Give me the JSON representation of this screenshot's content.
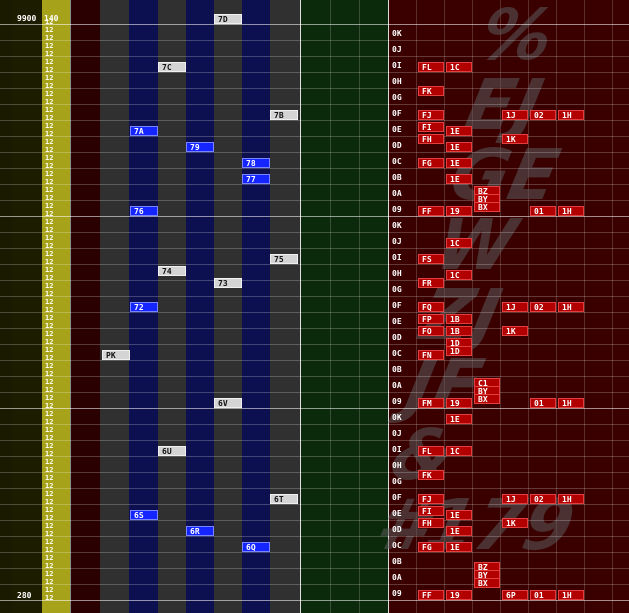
{
  "header": {
    "left_value": "9900",
    "right_value": "140"
  },
  "footer": {
    "measure_start": "280"
  },
  "colors": {
    "beat_column": "#a6a21a",
    "bg_dark_red": "#3a0000",
    "bg_blue_lane": "#0d1050",
    "bg_gray_lane": "#303030",
    "bg_green_lane": "#0b2a0b",
    "note_gray": "#d4d4d4",
    "note_blue": "#1525ff",
    "note_red": "#b20000"
  },
  "measure_labels": [
    "0K",
    "0J",
    "0I",
    "0H",
    "0G",
    "0F",
    "0E",
    "0D",
    "0C",
    "0B",
    "0A",
    "09",
    "0K",
    "0J",
    "0I",
    "0H",
    "0G",
    "0F",
    "0E",
    "0D",
    "0C",
    "0B",
    "0A",
    "09",
    "0K",
    "0J",
    "0I",
    "0H",
    "0G",
    "0F",
    "0E",
    "0D",
    "0C",
    "0B",
    "0A",
    "09"
  ],
  "beat_values": [
    "12",
    "12",
    "12",
    "12",
    "12",
    "12",
    "12",
    "12",
    "12",
    "12",
    "12",
    "12",
    "12",
    "12",
    "12",
    "12",
    "12",
    "12",
    "12",
    "12",
    "12",
    "12",
    "12",
    "12",
    "12",
    "12",
    "12",
    "12",
    "12",
    "12",
    "12",
    "12",
    "12",
    "12",
    "12",
    "12",
    "12",
    "12",
    "12",
    "12",
    "12",
    "12",
    "12",
    "12",
    "12",
    "12",
    "12",
    "12",
    "12",
    "12",
    "12",
    "12",
    "12",
    "12",
    "12",
    "12",
    "12",
    "12",
    "12",
    "12",
    "12",
    "12",
    "12",
    "12",
    "12",
    "12",
    "12",
    "12",
    "12",
    "12",
    "12",
    "12",
    "12",
    "12"
  ],
  "lane_notes": {
    "gray": [
      {
        "label": "7D"
      },
      {
        "label": "7C"
      },
      {
        "label": "7B"
      },
      {
        "label": "7A-"
      },
      {
        "label": "74"
      },
      {
        "label": "73"
      },
      {
        "label": "75"
      },
      {
        "label": "PK"
      },
      {
        "label": "6V"
      },
      {
        "label": "6U"
      },
      {
        "label": "6T"
      }
    ],
    "blue": [
      {
        "label": "7A"
      },
      {
        "label": "79"
      },
      {
        "label": "78"
      },
      {
        "label": "77"
      },
      {
        "label": "76"
      },
      {
        "label": "72"
      },
      {
        "label": "6S"
      },
      {
        "label": "6R"
      },
      {
        "label": "6Q"
      }
    ]
  },
  "event_notes": [
    {
      "label": "FL"
    },
    {
      "label": "1C"
    },
    {
      "label": "FK"
    },
    {
      "label": "FJ"
    },
    {
      "label": "1J"
    },
    {
      "label": "02"
    },
    {
      "label": "1H"
    },
    {
      "label": "FI"
    },
    {
      "label": "FH"
    },
    {
      "label": "1E"
    },
    {
      "label": "1K"
    },
    {
      "label": "1E"
    },
    {
      "label": "FG"
    },
    {
      "label": "1E"
    },
    {
      "label": "1E"
    },
    {
      "label": "BZ"
    },
    {
      "label": "BY"
    },
    {
      "label": "BX"
    },
    {
      "label": "FF"
    },
    {
      "label": "19"
    },
    {
      "label": "01"
    },
    {
      "label": "1H"
    },
    {
      "label": "1C"
    },
    {
      "label": "FS"
    },
    {
      "label": "1C"
    },
    {
      "label": "FR"
    },
    {
      "label": "FQ"
    },
    {
      "label": "1J"
    },
    {
      "label": "02"
    },
    {
      "label": "1H"
    },
    {
      "label": "FP"
    },
    {
      "label": "1B"
    },
    {
      "label": "FO"
    },
    {
      "label": "1B"
    },
    {
      "label": "1K"
    },
    {
      "label": "1D"
    },
    {
      "label": "FN"
    },
    {
      "label": "1D"
    },
    {
      "label": "C1"
    },
    {
      "label": "BY"
    },
    {
      "label": "BX"
    },
    {
      "label": "FM"
    },
    {
      "label": "19"
    },
    {
      "label": "01"
    },
    {
      "label": "1H"
    },
    {
      "label": "1E"
    },
    {
      "label": "FL"
    },
    {
      "label": "1C"
    },
    {
      "label": "FK"
    },
    {
      "label": "FJ"
    },
    {
      "label": "1J"
    },
    {
      "label": "02"
    },
    {
      "label": "1H"
    },
    {
      "label": "FI"
    },
    {
      "label": "FH"
    },
    {
      "label": "1E"
    },
    {
      "label": "1K"
    },
    {
      "label": "1E"
    },
    {
      "label": "FG"
    },
    {
      "label": "1E"
    },
    {
      "label": "BZ"
    },
    {
      "label": "BY"
    },
    {
      "label": "BX"
    },
    {
      "label": "FF"
    },
    {
      "label": "19"
    },
    {
      "label": "6P"
    },
    {
      "label": "01"
    },
    {
      "label": "1H"
    }
  ],
  "watermark": {
    "text": "#179"
  }
}
